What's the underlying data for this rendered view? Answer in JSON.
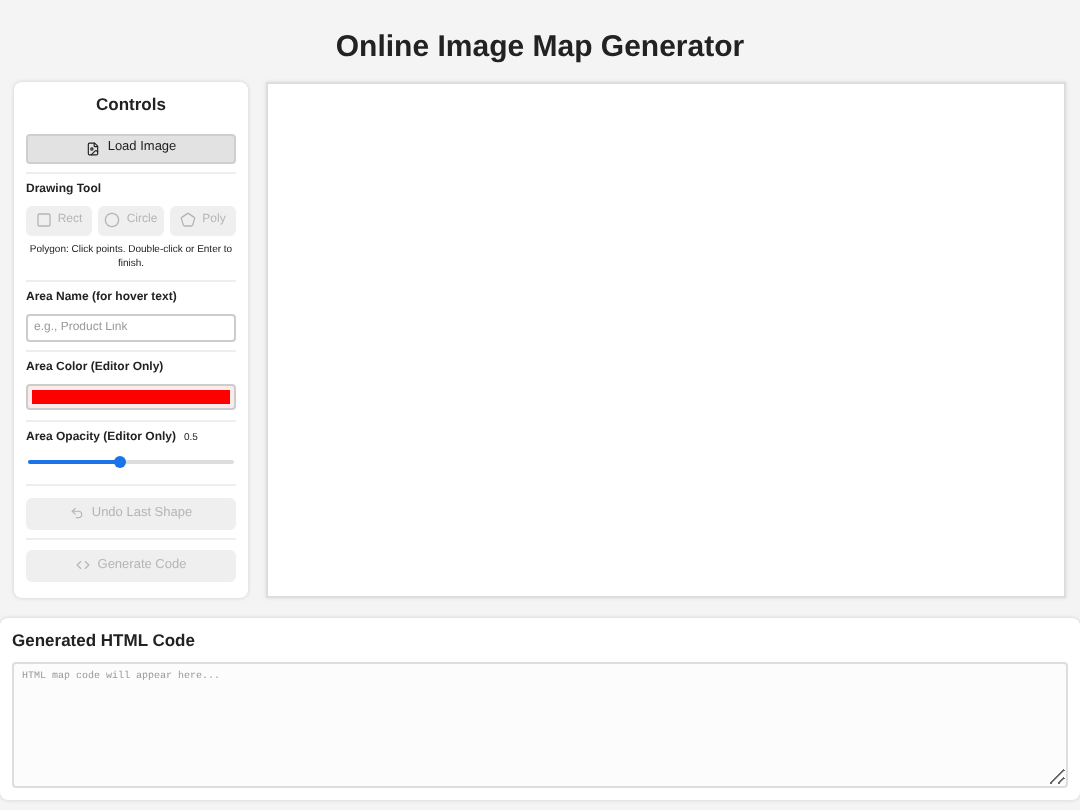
{
  "title": "Online Image Map Generator",
  "controls": {
    "heading": "Controls",
    "load_button": "Load Image",
    "drawing_tool_label": "Drawing Tool",
    "tools": [
      {
        "kind": "rect",
        "label": "Rect",
        "selected": false,
        "disabled": true
      },
      {
        "kind": "circle",
        "label": "Circle",
        "selected": false,
        "disabled": true
      },
      {
        "kind": "poly",
        "label": "Poly",
        "selected": false,
        "disabled": true
      }
    ],
    "hint": "Polygon: Click points. Double-click or Enter to finish.",
    "area_name": {
      "label": "Area Name (for hover text)",
      "placeholder": "e.g., Product Link"
    },
    "area_color": {
      "label": "Area Color (Editor Only)",
      "color": "#ff0000"
    },
    "area_opacity": {
      "label": "Area Opacity (Editor Only)",
      "reading": "0.5",
      "level": 0.45
    },
    "undo_button": {
      "label": "Undo Last Shape",
      "disabled": true
    },
    "generate_button": {
      "label": "Generate Code",
      "disabled": true
    }
  },
  "output": {
    "heading": "Generated HTML Code",
    "placeholder": "HTML map code will appear here..."
  }
}
